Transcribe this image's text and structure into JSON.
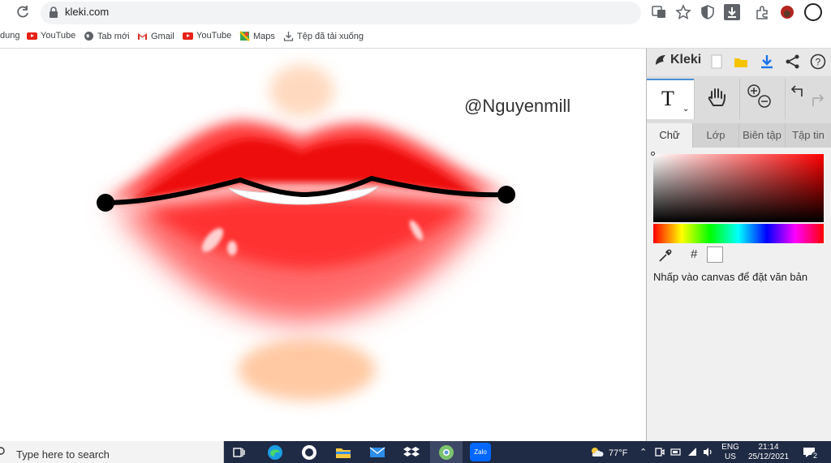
{
  "browser": {
    "url": "kleki.com",
    "bookmarks": [
      {
        "label": "dung",
        "icon": "none"
      },
      {
        "label": "YouTube",
        "icon": "youtube-icon"
      },
      {
        "label": "Tab mới",
        "icon": "globe-icon"
      },
      {
        "label": "Gmail",
        "icon": "gmail-icon"
      },
      {
        "label": "YouTube",
        "icon": "youtube-icon"
      },
      {
        "label": "Maps",
        "icon": "maps-icon"
      },
      {
        "label": "Tệp đã tải xuống",
        "icon": "download-icon"
      }
    ]
  },
  "canvas": {
    "watermark": "@Nguyenmill"
  },
  "panel": {
    "logo": "Kleki",
    "active_tool": "T",
    "tabs": [
      "Chữ",
      "Lớp",
      "Biên tập",
      "Tập tin"
    ],
    "active_tab": "Chữ",
    "hex_label": "#",
    "hint": "Nhấp vào canvas để đặt văn bản",
    "colors": {
      "selected": "#ffffff",
      "accent": "#4a90d9"
    }
  },
  "taskbar": {
    "search_placeholder": "Type here to search",
    "weather": "77°F",
    "lang_top": "ENG",
    "lang_bottom": "US",
    "time": "21:14",
    "date": "25/12/2021",
    "notification_count": "2"
  }
}
